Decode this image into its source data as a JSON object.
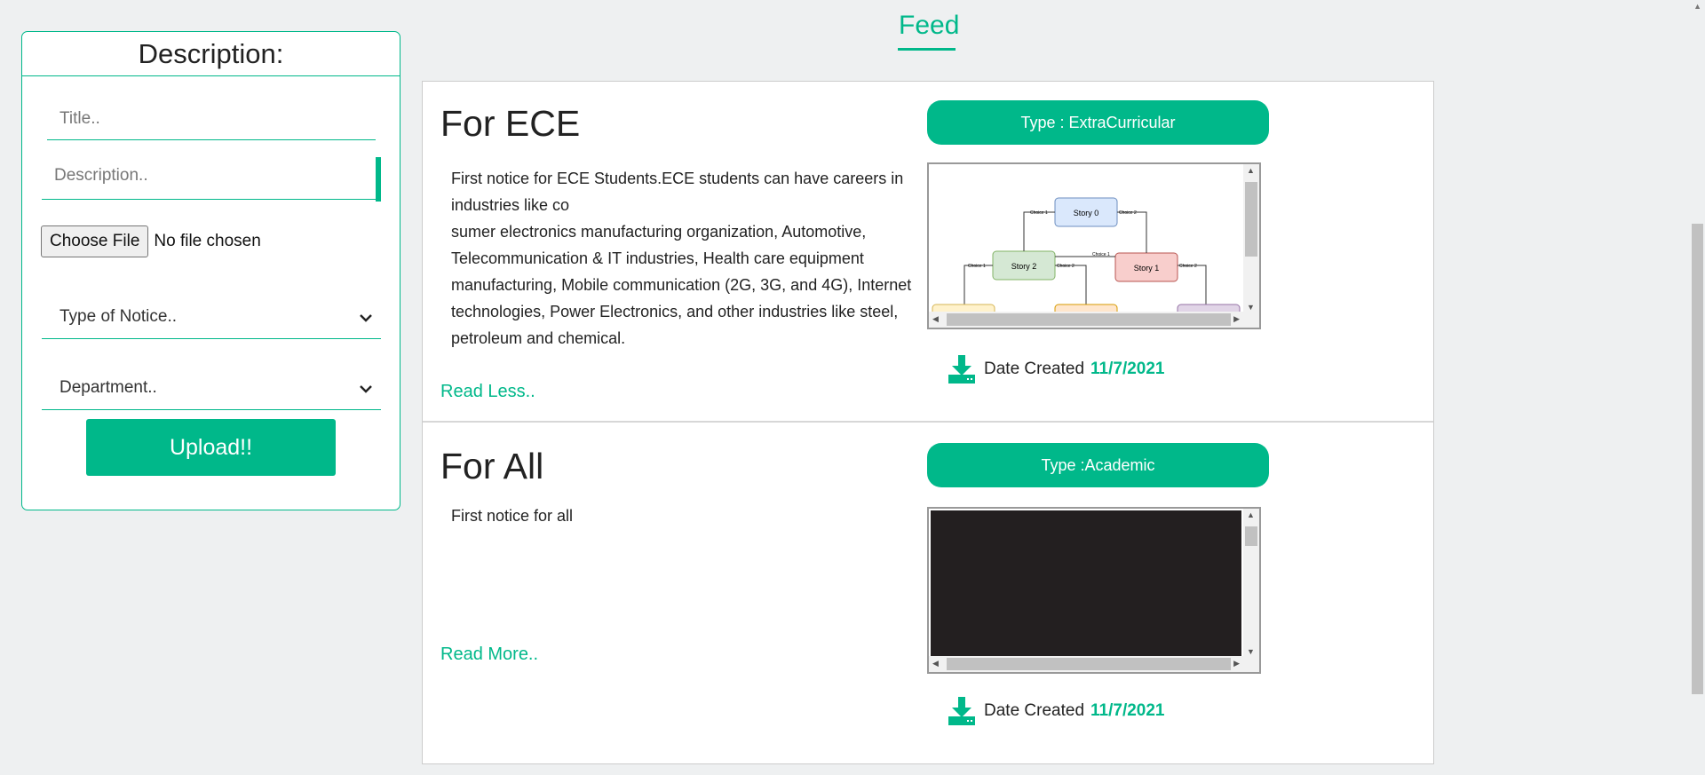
{
  "form": {
    "title": "Description:",
    "title_placeholder": "Title..",
    "description_placeholder": "Description..",
    "file_button": "Choose File",
    "file_status": "No file chosen",
    "type_select": "Type of Notice..",
    "department_select": "Department..",
    "upload_button": "Upload!!"
  },
  "feed": {
    "heading": "Feed",
    "cards": [
      {
        "title": "For ECE",
        "type_label": "Type : ExtraCurricular",
        "body_lines": [
          "First notice for ECE Students.ECE students can have careers in industries like co",
          "sumer electronics manufacturing organization, Automotive, Telecommunication & IT industries, Health care equipment manufacturing, Mobile communication (2G, 3G, and 4G), Internet technologies, Power Electronics, and other industries like steel, petroleum and chemical."
        ],
        "read_link": "Read Less..",
        "date_label": "Date Created",
        "date_value": "11/7/2021",
        "diagram": {
          "nodes": [
            "Story 0",
            "Story 2",
            "Story 1"
          ],
          "edges": [
            "Choice 1",
            "Choice 2",
            "Choice 1",
            "Choice 2",
            "Choice 1",
            "Choice 2"
          ]
        }
      },
      {
        "title": "For All",
        "type_label": "Type :Academic",
        "body_lines": [
          "First notice for all"
        ],
        "read_link": "Read More..",
        "date_label": "Date Created",
        "date_value": "11/7/2021"
      }
    ]
  },
  "colors": {
    "accent": "#00b88a",
    "background": "#eef0f1"
  },
  "icons": {
    "download": "download-icon",
    "select": "chevron-down-icon"
  }
}
